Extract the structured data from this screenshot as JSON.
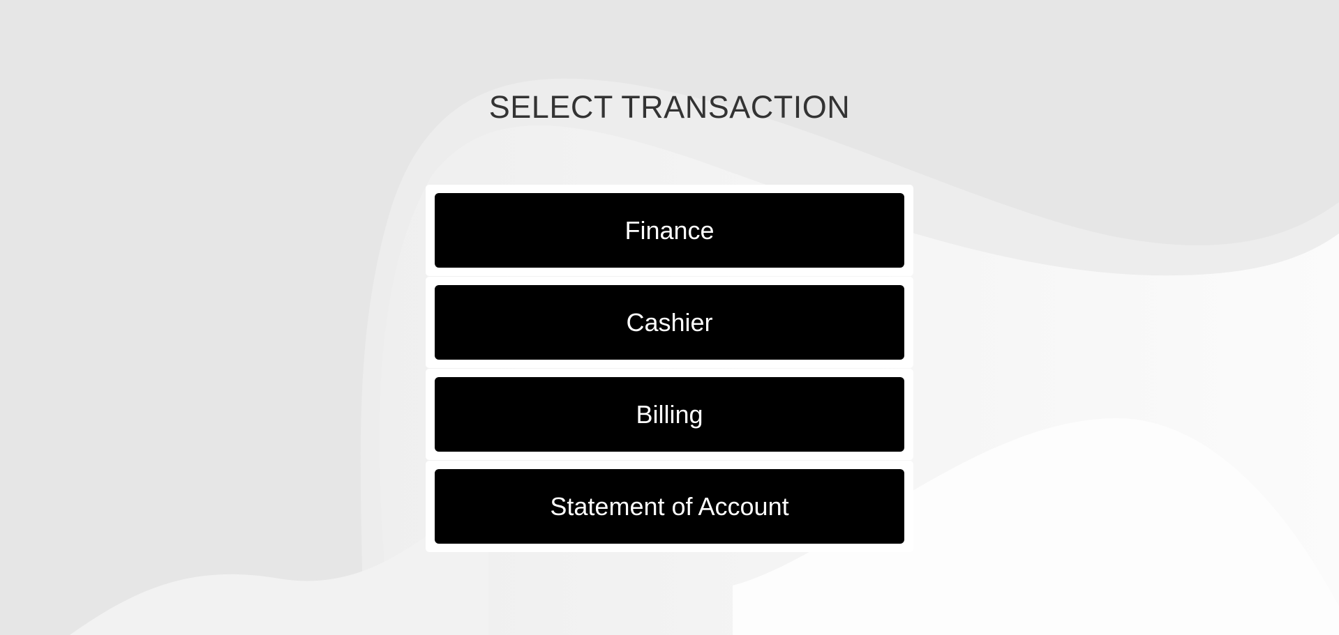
{
  "page": {
    "title": "SELECT TRANSACTION"
  },
  "transactions": [
    {
      "label": "Finance"
    },
    {
      "label": "Cashier"
    },
    {
      "label": "Billing"
    },
    {
      "label": "Statement of Account"
    }
  ],
  "colors": {
    "background": "#e6e6e6",
    "button": "#000000",
    "button_text": "#ffffff",
    "title": "#333333"
  }
}
